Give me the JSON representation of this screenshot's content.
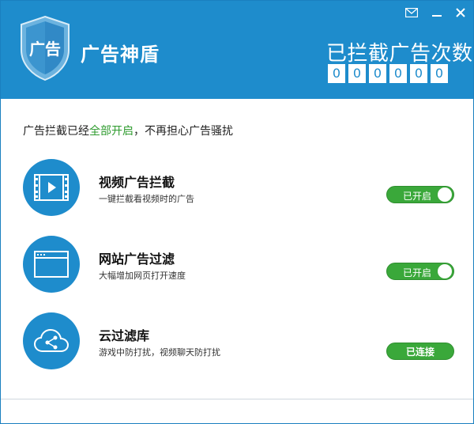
{
  "app": {
    "title": "广告神盾",
    "logo_text": "广告",
    "logo_icon": "shield-icon"
  },
  "window_controls": {
    "mail_icon": "mail-icon",
    "minimize_icon": "minimize-icon",
    "close_icon": "close-icon"
  },
  "counter": {
    "title": "已拦截广告次数",
    "digits": [
      "0",
      "0",
      "0",
      "0",
      "0",
      "0"
    ]
  },
  "status": {
    "prefix": "广告拦截已经",
    "highlight": "全部开启",
    "suffix": "，不再担心广告骚扰",
    "highlight_color": "#2e9b2e"
  },
  "features": [
    {
      "title": "视频广告拦截",
      "description": "一键拦截看视频时的广告",
      "state_label": "已开启",
      "icon": "video-icon"
    },
    {
      "title": "网站广告过滤",
      "description": "大幅增加网页打开速度",
      "state_label": "已开启",
      "icon": "browser-window-icon"
    },
    {
      "title": "云过滤库",
      "description": "游戏中防打扰，视频聊天防打扰",
      "state_label": "已连接",
      "icon": "cloud-share-icon"
    }
  ],
  "colors": {
    "brand_blue": "#1e8ccc",
    "toggle_green": "#3aa83a"
  }
}
